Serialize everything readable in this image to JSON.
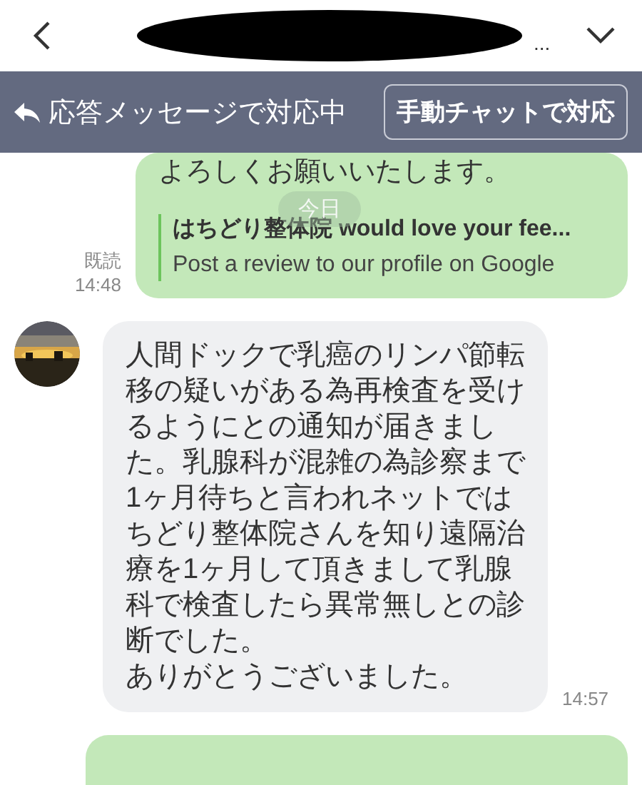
{
  "header": {
    "title": "...",
    "redacted": true
  },
  "banner": {
    "status": "応答メッセージで対応中",
    "button": "手動チャットで対応"
  },
  "date_chip": "今日",
  "messages": [
    {
      "kind": "outgoing",
      "text": "よろしくお願いいたします。",
      "link_title": "はちどり整体院 would love your fee...",
      "link_text": "Post a review to our profile on Google",
      "read": "既読",
      "time": "14:48"
    },
    {
      "kind": "incoming",
      "lines": [
        "人間ドックで乳癌のリンパ節転",
        "移の疑いがある為再検査を受け",
        "るようにとの通知が届きまし",
        "た。乳腺科が混雑の為診察まで",
        "1ヶ月待ちと言われネットでは",
        "ちどり整体院さんを知り遠隔治",
        "療を1ヶ月して頂きまして乳腺",
        "科で検査したら異常無しとの診",
        "断でした。",
        "ありがとうございました。"
      ],
      "time": "14:57"
    },
    {
      "kind": "outgoing_partial"
    }
  ]
}
